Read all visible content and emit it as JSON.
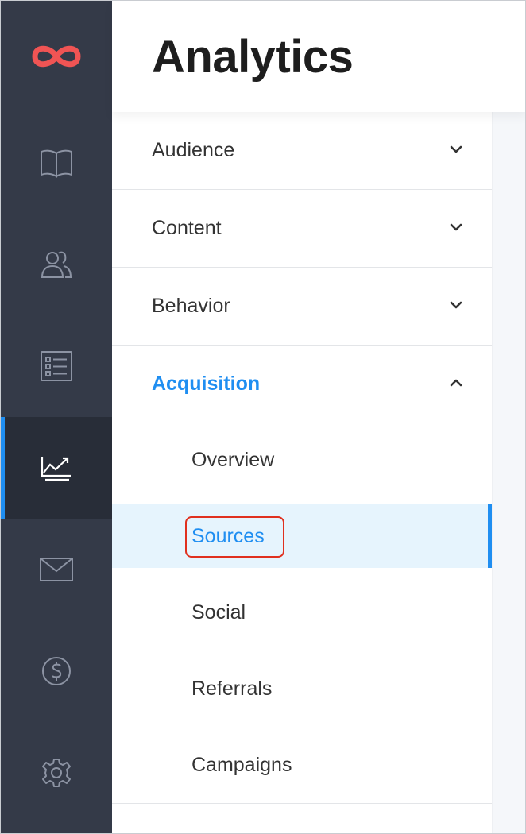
{
  "header": {
    "title": "Analytics"
  },
  "rail": {
    "logo_icon": "infinity-logo-icon",
    "items": [
      {
        "icon": "book-icon",
        "active": false
      },
      {
        "icon": "users-icon",
        "active": false
      },
      {
        "icon": "checklist-icon",
        "active": false
      },
      {
        "icon": "analytics-chart-icon",
        "active": true
      },
      {
        "icon": "mail-icon",
        "active": false
      },
      {
        "icon": "dollar-icon",
        "active": false
      },
      {
        "icon": "gear-icon",
        "active": false
      }
    ]
  },
  "menu": {
    "sections": [
      {
        "label": "Audience",
        "expanded": false
      },
      {
        "label": "Content",
        "expanded": false
      },
      {
        "label": "Behavior",
        "expanded": false
      },
      {
        "label": "Acquisition",
        "expanded": true
      }
    ],
    "acquisition_items": [
      {
        "label": "Overview",
        "selected": false
      },
      {
        "label": "Sources",
        "selected": true
      },
      {
        "label": "Social",
        "selected": false
      },
      {
        "label": "Referrals",
        "selected": false
      },
      {
        "label": "Campaigns",
        "selected": false
      }
    ]
  },
  "colors": {
    "rail_bg": "#343a48",
    "rail_active_bg": "#282d38",
    "accent": "#1f8ef1",
    "logo": "#f05454",
    "selected_bg": "#e6f4fd",
    "highlight_ring": "#e0301e"
  }
}
